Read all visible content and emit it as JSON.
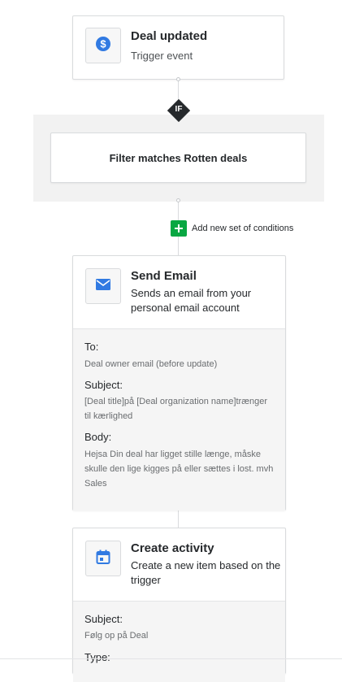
{
  "trigger": {
    "icon": "dollar-icon",
    "title": "Deal updated",
    "subtitle": "Trigger event"
  },
  "condition": {
    "badge": "IF",
    "filter_text": "Filter matches Rotten deals",
    "add_conditions_label": "Add new set of conditions"
  },
  "actions": [
    {
      "icon": "mail-icon",
      "title": "Send Email",
      "description": "Sends an email from your personal email account",
      "fields": [
        {
          "label": "To:",
          "value": "Deal owner email (before update)"
        },
        {
          "label": "Subject:",
          "value": "[Deal title]på [Deal organization name]trænger til kærlighed"
        },
        {
          "label": "Body:",
          "value": "Hejsa Din deal har ligget stille længe, måske skulle den lige kigges på eller sættes i lost. mvh Sales"
        }
      ]
    },
    {
      "icon": "calendar-icon",
      "title": "Create activity",
      "description": "Create a new item based on the trigger",
      "fields": [
        {
          "label": "Subject:",
          "value": "Følg op på Deal"
        },
        {
          "label": "Type:",
          "value": ""
        }
      ]
    }
  ],
  "colors": {
    "accent_blue": "#317ae2",
    "add_green": "#08a742",
    "if_badge": "#26292c",
    "filter_band": "#f2f2f2"
  }
}
